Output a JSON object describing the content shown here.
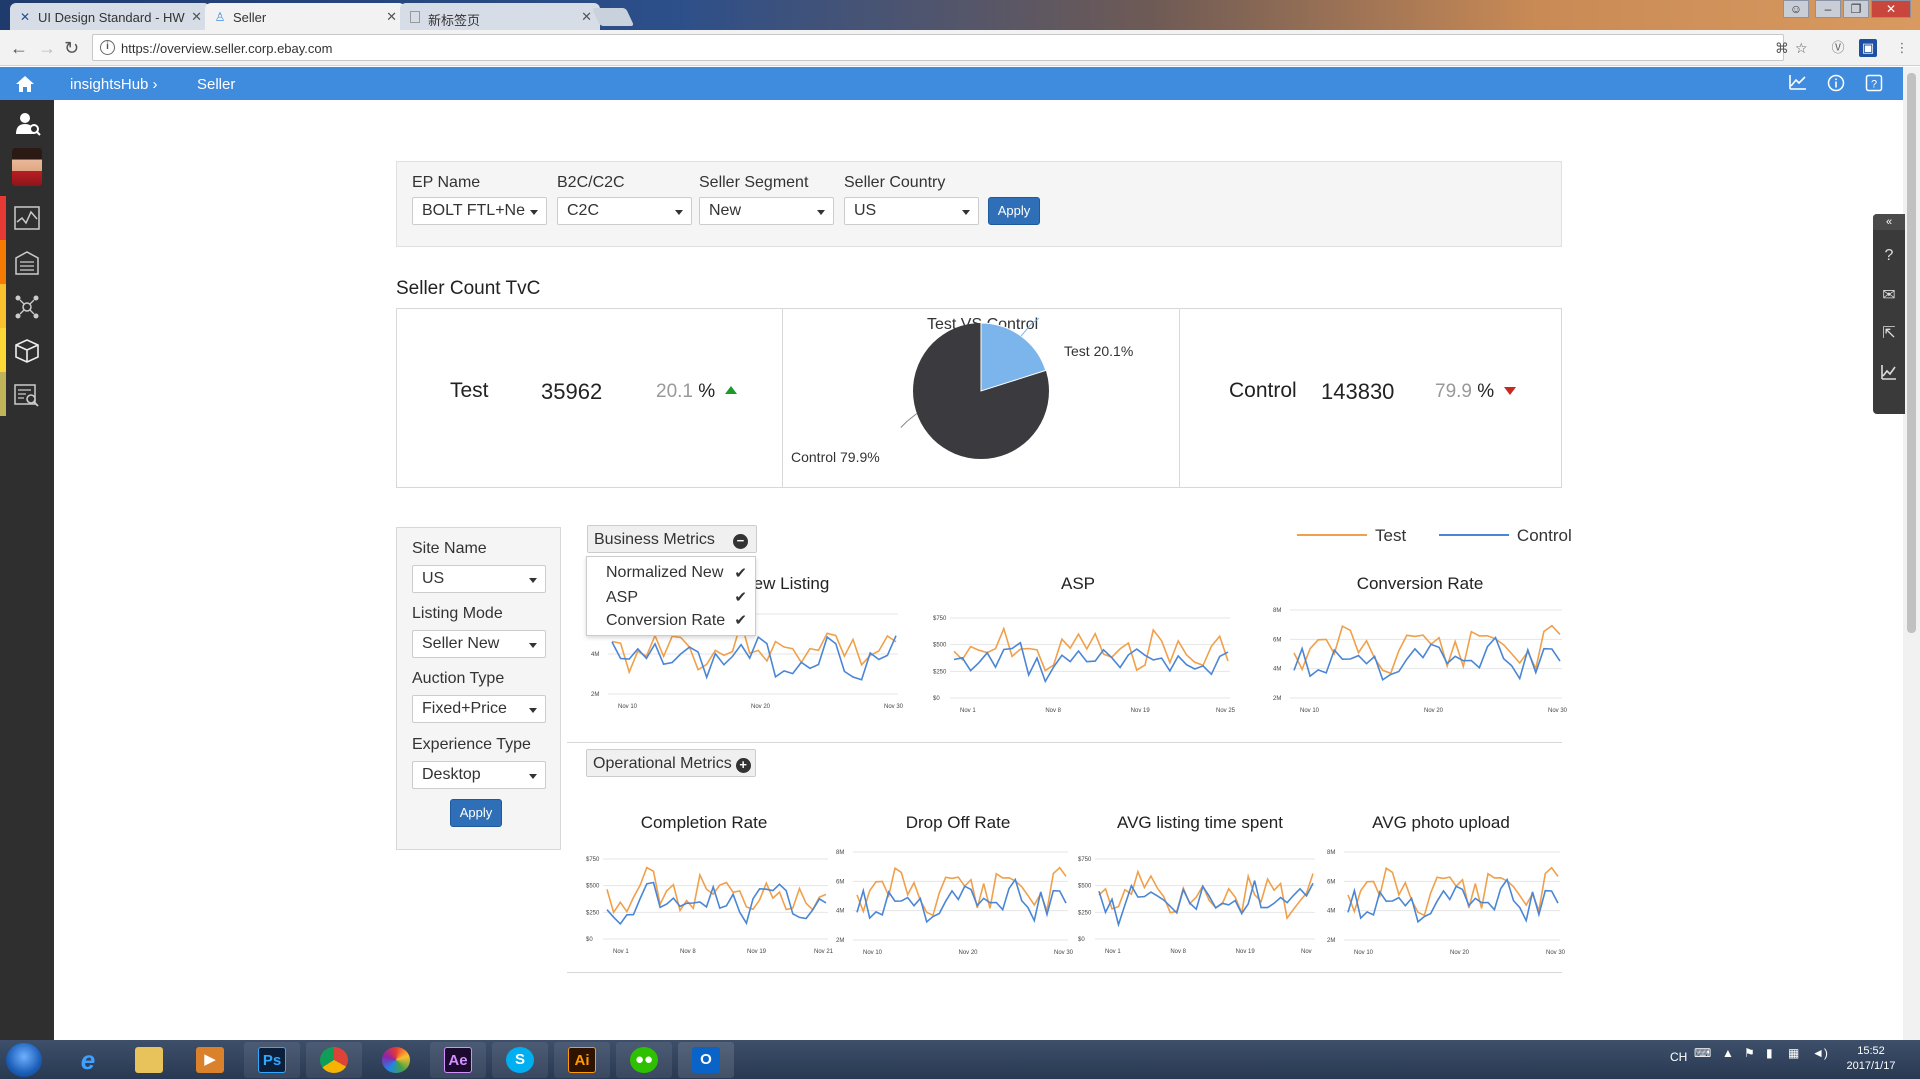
{
  "browser": {
    "tabs": [
      {
        "title": "UI Design Standard - HW",
        "icon": "x-logo-icon"
      },
      {
        "title": "Seller",
        "icon": "seller-app-icon"
      },
      {
        "title": "新标签页",
        "icon": "blank-page-icon"
      }
    ],
    "url": "https://overview.seller.corp.ebay.com"
  },
  "header": {
    "breadcrumb_root": "insightsHub",
    "breadcrumb_current": "Seller"
  },
  "filters": {
    "ep_name": {
      "label": "EP Name",
      "value": "BOLT FTL+Ne"
    },
    "b2c_c2c": {
      "label": "B2C/C2C",
      "value": "C2C"
    },
    "seller_segment": {
      "label": "Seller Segment",
      "value": "New"
    },
    "seller_country": {
      "label": "Seller Country",
      "value": "US"
    },
    "apply_label": "Apply"
  },
  "tvc": {
    "section_title": "Seller Count TvC",
    "test": {
      "label": "Test",
      "count": "35962",
      "pct": "20.1",
      "trend": "up"
    },
    "control": {
      "label": "Control",
      "count": "143830",
      "pct": "79.9",
      "trend": "down"
    },
    "pct_unit": "%",
    "pie": {
      "title": "Test VS Control",
      "test_label": "Test  20.1%",
      "control_label": "Control  79.9%",
      "test_share": 0.201,
      "colors": {
        "test": "#7cb4ec",
        "control": "#3a3a3f"
      }
    }
  },
  "side_filters": {
    "site_name": {
      "label": "Site Name",
      "value": "US"
    },
    "listing_mode": {
      "label": "Listing Mode",
      "value": "Seller New"
    },
    "auction_type": {
      "label": "Auction Type",
      "value": "Fixed+Price"
    },
    "experience_type": {
      "label": "Experience Type",
      "value": "Desktop"
    },
    "apply_label": "Apply"
  },
  "metrics": {
    "business_label": "Business Metrics",
    "business_dropdown": [
      "Normalized New",
      "ASP",
      "Conversion Rate"
    ],
    "operational_label": "Operational Metrics",
    "legend": {
      "test": "Test",
      "control": "Control"
    },
    "colors": {
      "test": "#f0a04b",
      "control": "#4a86d6"
    },
    "business_charts": [
      {
        "title": "Normalized New Listing",
        "title_visible": "w Listing",
        "yticks": [
          "",
          "4M",
          "2M"
        ],
        "xticks": [
          "Nov 10",
          "Nov 20",
          "Nov 30"
        ]
      },
      {
        "title": "ASP",
        "yticks": [
          "$750",
          "$500",
          "$250",
          "$0"
        ],
        "xticks": [
          "Nov 1",
          "Nov 8",
          "Nov 19",
          "Nov 25"
        ]
      },
      {
        "title": "Conversion Rate",
        "yticks": [
          "8M",
          "6M",
          "4M",
          "2M"
        ],
        "xticks": [
          "Nov 10",
          "Nov 20",
          "Nov 30"
        ]
      }
    ],
    "operational_charts": [
      {
        "title": "Completion Rate",
        "yticks": [
          "$750",
          "$500",
          "$250",
          "$0"
        ],
        "xticks": [
          "Nov 1",
          "Nov 8",
          "Nov 19",
          "Nov 21"
        ]
      },
      {
        "title": "Drop Off Rate",
        "yticks": [
          "8M",
          "6M",
          "4M",
          "2M"
        ],
        "xticks": [
          "Nov 10",
          "Nov 20",
          "Nov 30"
        ]
      },
      {
        "title": "AVG listing time spent",
        "yticks": [
          "$750",
          "$500",
          "$250",
          "$0"
        ],
        "xticks": [
          "Nov 1",
          "Nov 8",
          "Nov 19",
          "Nov"
        ]
      },
      {
        "title": "AVG photo upload",
        "yticks": [
          "8M",
          "6M",
          "4M",
          "2M"
        ],
        "xticks": [
          "Nov 10",
          "Nov 20",
          "Nov 30"
        ]
      }
    ]
  },
  "taskbar": {
    "apps": [
      "internet-explorer-icon",
      "file-explorer-icon",
      "media-player-icon",
      "photoshop-icon",
      "chrome-icon",
      "color-wheel-icon",
      "after-effects-icon",
      "skype-icon",
      "illustrator-icon",
      "wechat-icon",
      "outlook-icon"
    ],
    "app_labels": {
      "ps": "Ps",
      "ae": "Ae",
      "ai": "Ai"
    },
    "lang": "CH",
    "time": "15:52",
    "date": "2017/1/17"
  }
}
